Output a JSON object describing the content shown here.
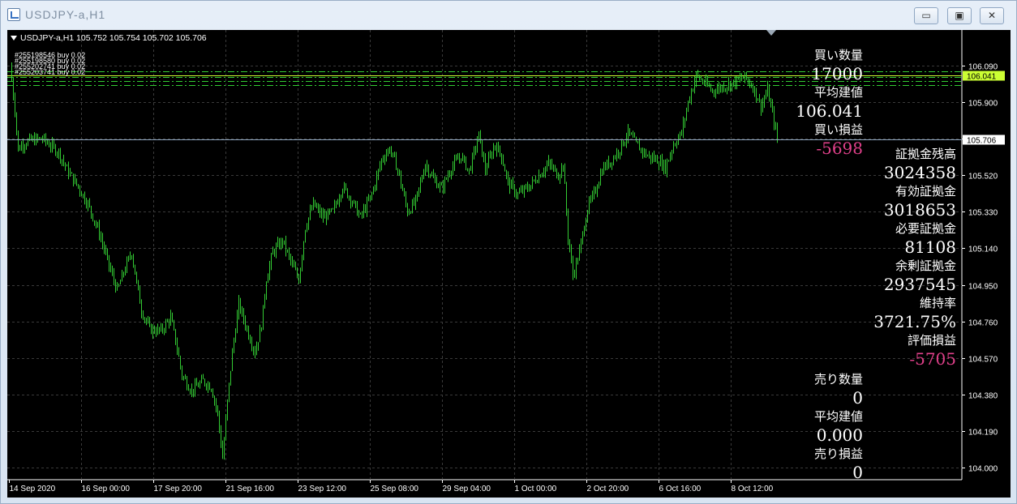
{
  "window": {
    "title": "USDJPY-a,H1",
    "buttons": {
      "minimize": "▭",
      "maximize": "▣",
      "close": "✕"
    }
  },
  "chart": {
    "header": "USDJPY-a,H1  105.752 105.754 105.702 105.706",
    "order_labels": [
      "#255198546 buy 0.02",
      "#255198580 buy 0.02",
      "#255202741 buy 0.02",
      "#255203741 buy 0.02"
    ],
    "colors": {
      "background": "#000000",
      "candle": "#33cc33",
      "grid": "#3a3a3a",
      "current_price": "#8fa6bf",
      "order_line": "#33cc33",
      "highlight": "#ccff33"
    }
  },
  "buy_panel": {
    "qty_label": "買い数量",
    "qty_value": "17000",
    "avg_label": "平均建値",
    "avg_value": "106.041",
    "pl_label": "買い損益",
    "pl_value": "-5698"
  },
  "account_panel": {
    "balance_label": "証拠金残高",
    "balance_value": "3024358",
    "equity_label": "有効証拠金",
    "equity_value": "3018653",
    "required_label": "必要証拠金",
    "required_value": "81108",
    "free_label": "余剰証拠金",
    "free_value": "2937545",
    "ratio_label": "維持率",
    "ratio_value": "3721.75%",
    "unrealized_label": "評価損益",
    "unrealized_value": "-5705"
  },
  "sell_panel": {
    "qty_label": "売り数量",
    "qty_value": "0",
    "avg_label": "平均建値",
    "avg_value": "0.000",
    "pl_label": "売り損益",
    "pl_value": "0"
  },
  "chart_data": {
    "type": "candlestick",
    "symbol": "USDJPY-a",
    "timeframe": "H1",
    "last_ohlc": {
      "open": 105.752,
      "high": 105.754,
      "low": 105.702,
      "close": 105.706
    },
    "current_price": 105.706,
    "price_highlight": 106.041,
    "y_ticks": [
      106.09,
      105.9,
      105.71,
      105.52,
      105.33,
      105.14,
      104.95,
      104.76,
      104.57,
      104.38,
      104.19,
      104.0
    ],
    "ylim": [
      104.0,
      106.09
    ],
    "x_ticks": [
      "14 Sep 2020",
      "16 Sep 00:00",
      "17 Sep 20:00",
      "21 Sep 16:00",
      "23 Sep 12:00",
      "25 Sep 08:00",
      "29 Sep 04:00",
      "1 Oct 00:00",
      "2 Oct 20:00",
      "6 Oct 16:00",
      "8 Oct 12:00"
    ],
    "order_levels": [
      106.06,
      106.03,
      106.01,
      105.99
    ],
    "close_path": [
      [
        0,
        106.09
      ],
      [
        6,
        105.86
      ],
      [
        10,
        105.65
      ],
      [
        14,
        105.68
      ],
      [
        24,
        105.7
      ],
      [
        40,
        105.71
      ],
      [
        60,
        105.64
      ],
      [
        70,
        105.55
      ],
      [
        84,
        105.46
      ],
      [
        96,
        105.37
      ],
      [
        110,
        105.22
      ],
      [
        122,
        105.05
      ],
      [
        132,
        104.92
      ],
      [
        144,
        105.06
      ],
      [
        150,
        105.12
      ],
      [
        156,
        104.96
      ],
      [
        162,
        104.82
      ],
      [
        172,
        104.72
      ],
      [
        186,
        104.71
      ],
      [
        198,
        104.78
      ],
      [
        205,
        104.64
      ],
      [
        212,
        104.48
      ],
      [
        224,
        104.4
      ],
      [
        238,
        104.45
      ],
      [
        248,
        104.42
      ],
      [
        256,
        104.28
      ],
      [
        262,
        104.05
      ],
      [
        268,
        104.34
      ],
      [
        274,
        104.6
      ],
      [
        282,
        104.85
      ],
      [
        292,
        104.72
      ],
      [
        302,
        104.6
      ],
      [
        310,
        104.74
      ],
      [
        316,
        104.98
      ],
      [
        324,
        105.12
      ],
      [
        336,
        105.18
      ],
      [
        348,
        105.05
      ],
      [
        356,
        104.98
      ],
      [
        364,
        105.25
      ],
      [
        374,
        105.37
      ],
      [
        386,
        105.3
      ],
      [
        398,
        105.33
      ],
      [
        410,
        105.46
      ],
      [
        420,
        105.4
      ],
      [
        432,
        105.3
      ],
      [
        446,
        105.42
      ],
      [
        458,
        105.6
      ],
      [
        468,
        105.66
      ],
      [
        478,
        105.55
      ],
      [
        490,
        105.33
      ],
      [
        500,
        105.38
      ],
      [
        512,
        105.58
      ],
      [
        522,
        105.5
      ],
      [
        532,
        105.45
      ],
      [
        544,
        105.56
      ],
      [
        556,
        105.62
      ],
      [
        566,
        105.54
      ],
      [
        578,
        105.73
      ],
      [
        586,
        105.55
      ],
      [
        598,
        105.68
      ],
      [
        606,
        105.62
      ],
      [
        614,
        105.48
      ],
      [
        626,
        105.42
      ],
      [
        640,
        105.46
      ],
      [
        652,
        105.52
      ],
      [
        664,
        105.58
      ],
      [
        676,
        105.52
      ],
      [
        682,
        105.58
      ],
      [
        688,
        105.2
      ],
      [
        694,
        105.0
      ],
      [
        702,
        105.12
      ],
      [
        712,
        105.35
      ],
      [
        720,
        105.42
      ],
      [
        730,
        105.55
      ],
      [
        742,
        105.6
      ],
      [
        752,
        105.66
      ],
      [
        762,
        105.74
      ],
      [
        772,
        105.68
      ],
      [
        786,
        105.62
      ],
      [
        798,
        105.6
      ],
      [
        808,
        105.56
      ],
      [
        818,
        105.68
      ],
      [
        828,
        105.74
      ],
      [
        836,
        105.9
      ],
      [
        846,
        106.04
      ],
      [
        856,
        106.0
      ],
      [
        866,
        105.96
      ],
      [
        878,
        105.98
      ],
      [
        892,
        106.0
      ],
      [
        906,
        106.03
      ],
      [
        916,
        105.98
      ],
      [
        926,
        105.88
      ],
      [
        934,
        105.96
      ],
      [
        942,
        105.8
      ],
      [
        946,
        105.706
      ]
    ]
  }
}
